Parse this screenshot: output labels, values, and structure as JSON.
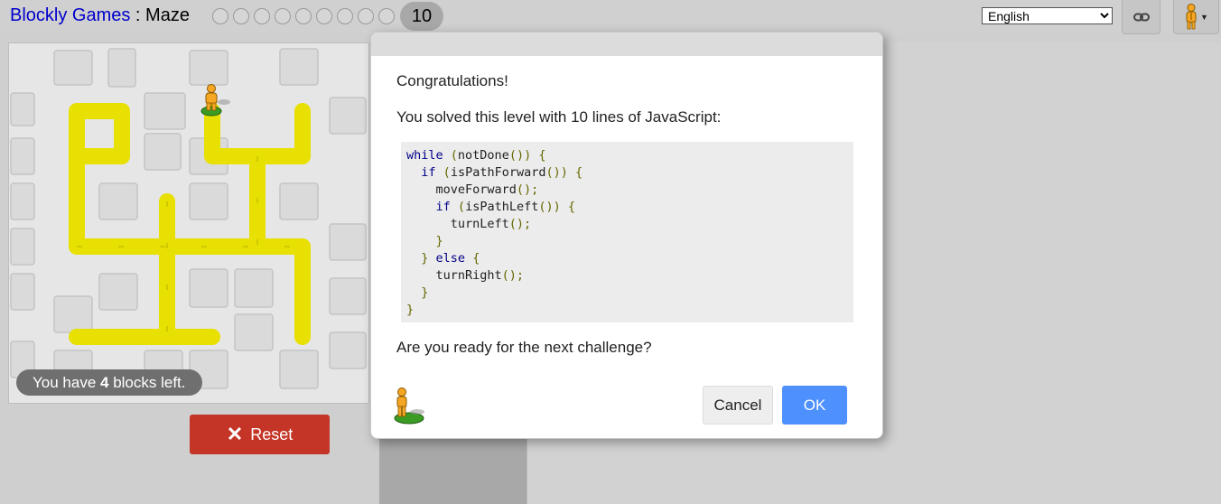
{
  "header": {
    "app_link": "Blockly Games",
    "separator": " : ",
    "game_name": "Maze",
    "completed_levels": 9,
    "current_level": "10",
    "language": "English"
  },
  "icons": {
    "link": "link-icon",
    "pegman": "pegman-icon",
    "reset": "close-icon"
  },
  "maze": {
    "blocks_left_prefix": "You have ",
    "blocks_left_count": "4",
    "blocks_left_suffix": " blocks left.",
    "reset_label": "Reset"
  },
  "dialog": {
    "heading": "Congratulations!",
    "solved_text": "You solved this level with 10 lines of JavaScript:",
    "code": [
      [
        {
          "t": "while",
          "c": "kw"
        },
        {
          "t": " "
        },
        {
          "t": "(",
          "c": "pn"
        },
        {
          "t": "notDone"
        },
        {
          "t": "())",
          "c": "pn"
        },
        {
          "t": " "
        },
        {
          "t": "{",
          "c": "pn"
        }
      ],
      [
        {
          "t": "  "
        },
        {
          "t": "if",
          "c": "kw"
        },
        {
          "t": " "
        },
        {
          "t": "(",
          "c": "pn"
        },
        {
          "t": "isPathForward"
        },
        {
          "t": "()) {",
          "c": "pn"
        }
      ],
      [
        {
          "t": "    moveForward"
        },
        {
          "t": "();",
          "c": "pn"
        }
      ],
      [
        {
          "t": "    "
        },
        {
          "t": "if",
          "c": "kw"
        },
        {
          "t": " "
        },
        {
          "t": "(",
          "c": "pn"
        },
        {
          "t": "isPathLeft"
        },
        {
          "t": "()) {",
          "c": "pn"
        }
      ],
      [
        {
          "t": "      turnLeft"
        },
        {
          "t": "();",
          "c": "pn"
        }
      ],
      [
        {
          "t": "    "
        },
        {
          "t": "}",
          "c": "pn"
        }
      ],
      [
        {
          "t": "  "
        },
        {
          "t": "}",
          "c": "pn"
        },
        {
          "t": " "
        },
        {
          "t": "else",
          "c": "kw"
        },
        {
          "t": " "
        },
        {
          "t": "{",
          "c": "pn"
        }
      ],
      [
        {
          "t": "    turnRight"
        },
        {
          "t": "();",
          "c": "pn"
        }
      ],
      [
        {
          "t": "  "
        },
        {
          "t": "}",
          "c": "pn"
        }
      ],
      [
        {
          "t": "}",
          "c": "pn"
        }
      ]
    ],
    "next_prompt": "Are you ready for the next challenge?",
    "cancel_label": "Cancel",
    "ok_label": "OK"
  },
  "colors": {
    "path": "#e8e000",
    "reset_button": "#c53527",
    "ok_button": "#4d90fe",
    "app_link": "#0000cc"
  }
}
